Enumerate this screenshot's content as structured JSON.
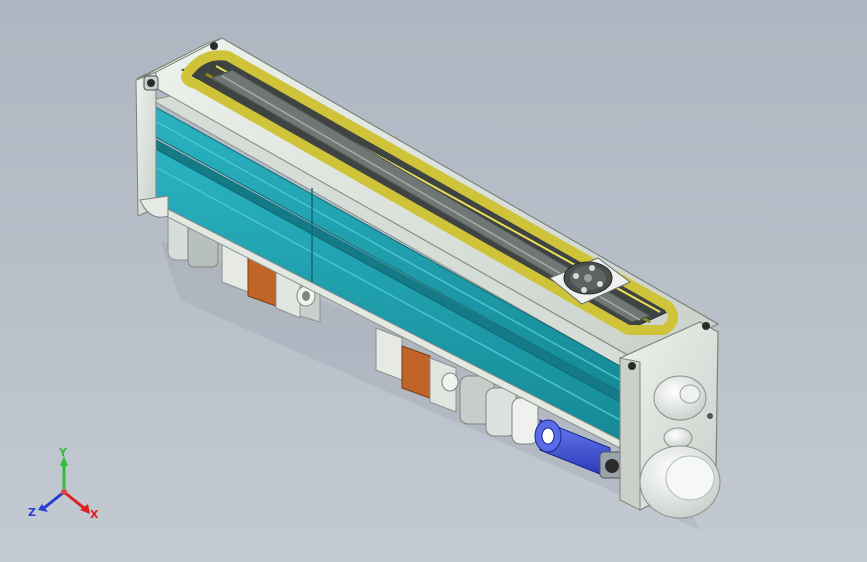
{
  "viewport": {
    "background_top": "#aeb6c1",
    "background_bottom": "#c4cad2"
  },
  "model": {
    "colors": {
      "frame": "#dde4dc",
      "frame_shade": "#b9c2bb",
      "rail_teal": "#1f9fae",
      "rail_teal_dark": "#147a86",
      "belt_yellow": "#cfc33a",
      "belt_dark": "#8e8420",
      "slot_dark": "#4d5250",
      "bearing_orange": "#c0642a",
      "coupling_blue": "#3a4fd6",
      "screw": "#2b2b2b"
    }
  },
  "triad": {
    "y_label": "Y",
    "z_label": "Z",
    "x_label": "X",
    "y_color": "#2fbf3a",
    "z_color": "#2a3fd0",
    "x_color": "#e02020"
  }
}
